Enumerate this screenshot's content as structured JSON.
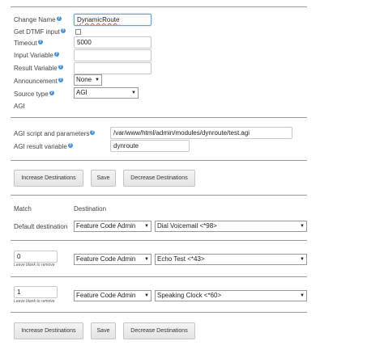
{
  "general": {
    "change_name_label": "Change Name",
    "change_name_value": "DynamicRoute",
    "get_dtmf_label": "Get DTMF input",
    "timeout_label": "Timeout",
    "timeout_value": "5000",
    "input_variable_label": "Input Variable",
    "input_variable_value": "",
    "result_variable_label": "Result Variable",
    "result_variable_value": "",
    "announcement_label": "Announcement",
    "announcement_value": "None",
    "source_type_label": "Source type",
    "source_type_value": "AGI"
  },
  "agi": {
    "section_label": "AGI",
    "script_label": "AGI script and parameters",
    "script_value": "/var/www/html/admin/modules/dynroute/test.agi",
    "result_label": "AGI result variable",
    "result_value": "dynroute"
  },
  "buttons": {
    "increase": "Increase Destinations",
    "save": "Save",
    "decrease": "Decrease Destinations"
  },
  "routes": {
    "match_header": "Match",
    "destination_header": "Destination",
    "default_label": "Default destination",
    "hint": "Leave blank to remove",
    "rows": [
      {
        "match": "",
        "category": "Feature Code Admin",
        "target": "Dial Voicemail <*98>"
      },
      {
        "match": "0",
        "category": "Feature Code Admin",
        "target": "Echo Test <*43>"
      },
      {
        "match": "1",
        "category": "Feature Code Admin",
        "target": "Speaking Clock <*60>"
      }
    ]
  },
  "help_glyph": "?",
  "dropdown_glyph": "▼"
}
